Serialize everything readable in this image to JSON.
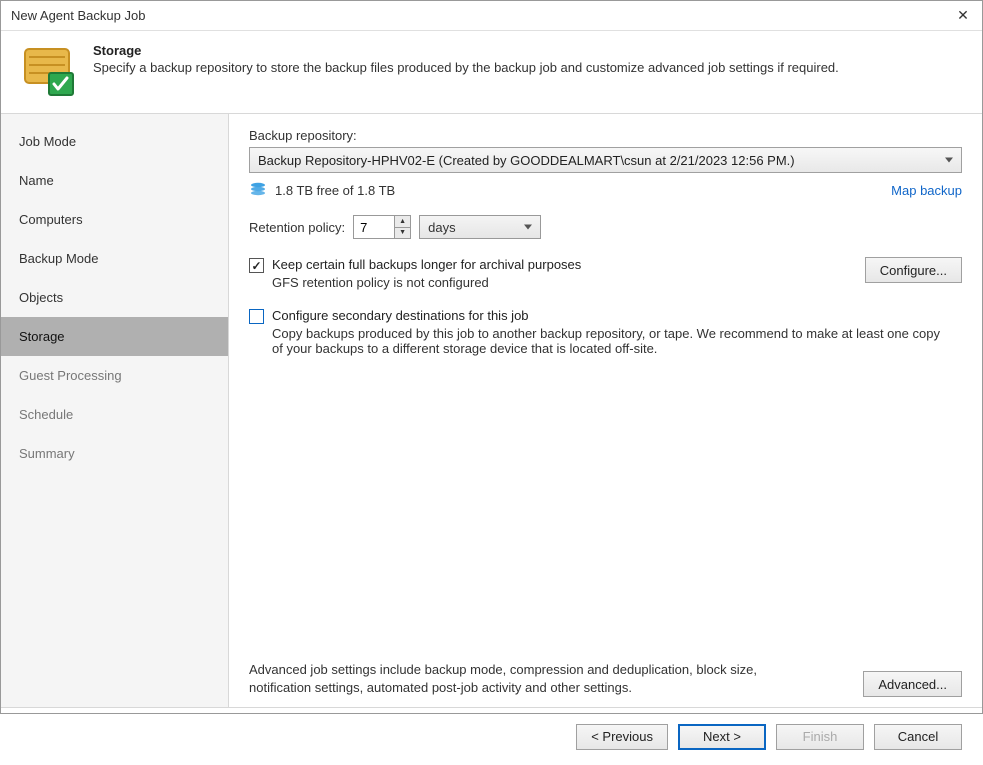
{
  "window": {
    "title": "New Agent Backup Job"
  },
  "header": {
    "title": "Storage",
    "subtitle": "Specify a backup repository to store the backup files produced by the backup job and customize advanced job settings if required."
  },
  "sidebar": {
    "items": [
      {
        "label": "Job Mode",
        "state": "completed"
      },
      {
        "label": "Name",
        "state": "completed"
      },
      {
        "label": "Computers",
        "state": "completed"
      },
      {
        "label": "Backup Mode",
        "state": "completed"
      },
      {
        "label": "Objects",
        "state": "completed"
      },
      {
        "label": "Storage",
        "state": "active"
      },
      {
        "label": "Guest Processing",
        "state": "pending"
      },
      {
        "label": "Schedule",
        "state": "pending"
      },
      {
        "label": "Summary",
        "state": "pending"
      }
    ]
  },
  "content": {
    "repo_label": "Backup repository:",
    "repo_selected": "Backup Repository-HPHV02-E (Created by GOODDEALMART\\csun at 2/21/2023 12:56 PM.)",
    "free_space": "1.8 TB free of 1.8 TB",
    "map_link": "Map backup",
    "retention_label": "Retention policy:",
    "retention_value": "7",
    "retention_unit": "days",
    "keep_full_label": "Keep certain full backups longer for archival purposes",
    "gfs_status": "GFS retention policy is not configured",
    "configure_button": "Configure...",
    "secondary_label": "Configure secondary destinations for this job",
    "secondary_help": "Copy backups produced by this job to another backup repository, or tape. We recommend to make at least one copy of your backups to a different storage device that is located off-site.",
    "advanced_help": "Advanced job settings include backup mode, compression and deduplication, block size, notification settings, automated post-job activity and other settings.",
    "advanced_button": "Advanced..."
  },
  "footer": {
    "previous": "< Previous",
    "next": "Next >",
    "finish": "Finish",
    "cancel": "Cancel"
  }
}
